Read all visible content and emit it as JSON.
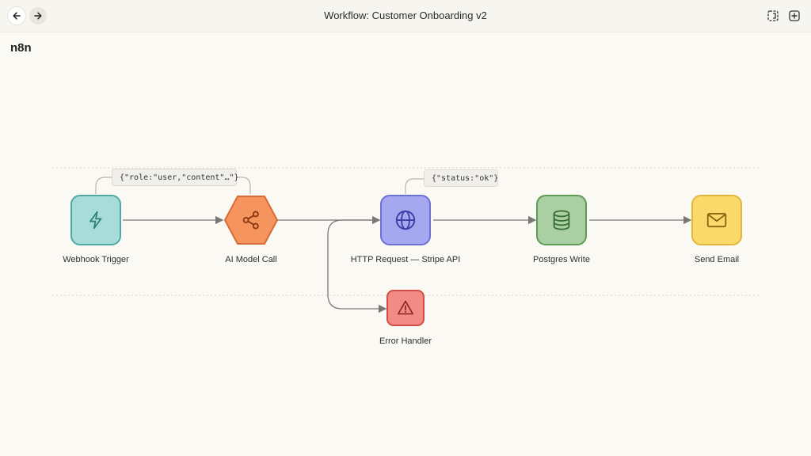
{
  "window": {
    "title": "Workflow: Customer Onboarding v2"
  },
  "brand": {
    "name": "n8n"
  },
  "toolbar": {
    "back_icon": "arrow-left-icon",
    "forward_icon": "arrow-right-icon",
    "right_icons": [
      "panel-toggle-icon",
      "add-icon"
    ]
  },
  "nodes": [
    {
      "id": "webhook",
      "label": "Webhook Trigger",
      "icon": "lightning-icon",
      "fill": "#a8dcd9",
      "border": "#4fa8a3"
    },
    {
      "id": "ai",
      "label": "AI Model Call",
      "icon": "share-icon",
      "fill": "#f6945e",
      "border": "#d66c36"
    },
    {
      "id": "http",
      "label": "HTTP Request — Stripe API",
      "icon": "globe-icon",
      "fill": "#a5a8ef",
      "border": "#6b6fd6"
    },
    {
      "id": "postgres",
      "label": "Postgres Write",
      "icon": "database-icon",
      "fill": "#a9cfa2",
      "border": "#5f9a56"
    },
    {
      "id": "email",
      "label": "Send Email",
      "icon": "mail-icon",
      "fill": "#fbd96a",
      "border": "#e2b63a"
    },
    {
      "id": "error",
      "label": "Error Handler",
      "icon": "warning-icon",
      "fill": "#f28b86",
      "border": "#cf4d47"
    }
  ],
  "payloads": [
    {
      "id": "ai_payload",
      "text": "{\"role:\"user,\"content\"…\"}"
    },
    {
      "id": "http_payload",
      "text": "{\"status:\"ok\"}"
    }
  ],
  "colors": {
    "canvas_bg": "#fbf9f4",
    "connector": "#7a7875",
    "guide": "#d6d2ca"
  }
}
